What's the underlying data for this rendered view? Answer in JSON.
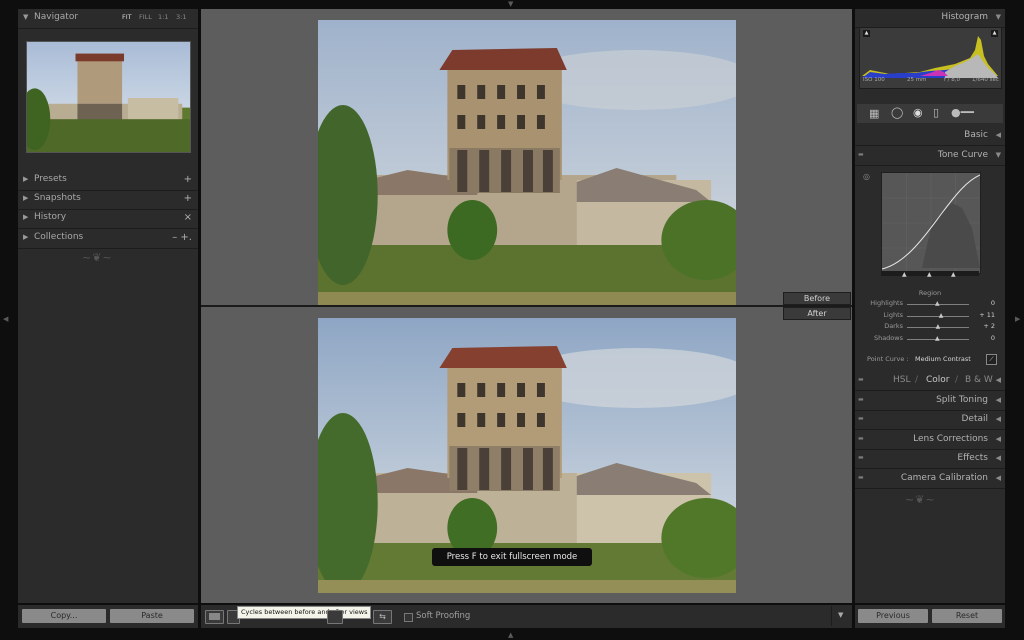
{
  "navigator": {
    "title": "Navigator",
    "zoom_options": [
      "FIT",
      "FILL",
      "1:1",
      "3:1"
    ],
    "active_zoom": "FIT"
  },
  "left_panels": [
    {
      "label": "Presets",
      "action": "+"
    },
    {
      "label": "Snapshots",
      "action": "+"
    },
    {
      "label": "History",
      "action": "×"
    },
    {
      "label": "Collections",
      "action": "–  +."
    }
  ],
  "left_buttons": {
    "copy": "Copy...",
    "paste": "Paste"
  },
  "view": {
    "before_label": "Before",
    "after_label": "After",
    "fullscreen_msg": "Press F to exit fullscreen mode"
  },
  "toolbar": {
    "tooltip": "Cycles between before and after views",
    "soft_proofing": "Soft Proofing"
  },
  "histogram": {
    "title": "Histogram",
    "iso": "ISO 100",
    "focal": "25 mm",
    "aperture": "f / 8,0",
    "shutter": "1/640 sec"
  },
  "right_panels": {
    "basic": "Basic",
    "tone_curve": "Tone Curve",
    "hsl": "HSL",
    "color": "Color",
    "bw": "B & W",
    "split_toning": "Split Toning",
    "detail": "Detail",
    "lens_corrections": "Lens Corrections",
    "effects": "Effects",
    "camera_calibration": "Camera Calibration"
  },
  "tone_curve": {
    "region_label": "Region",
    "sliders": [
      {
        "label": "Highlights",
        "value": "0",
        "pos": 0.5
      },
      {
        "label": "Lights",
        "value": "+ 11",
        "pos": 0.56
      },
      {
        "label": "Darks",
        "value": "+ 2",
        "pos": 0.51
      },
      {
        "label": "Shadows",
        "value": "0",
        "pos": 0.5
      }
    ],
    "point_curve_label": "Point Curve :",
    "point_curve_value": "Medium Contrast"
  },
  "right_buttons": {
    "previous": "Previous",
    "reset": "Reset"
  }
}
